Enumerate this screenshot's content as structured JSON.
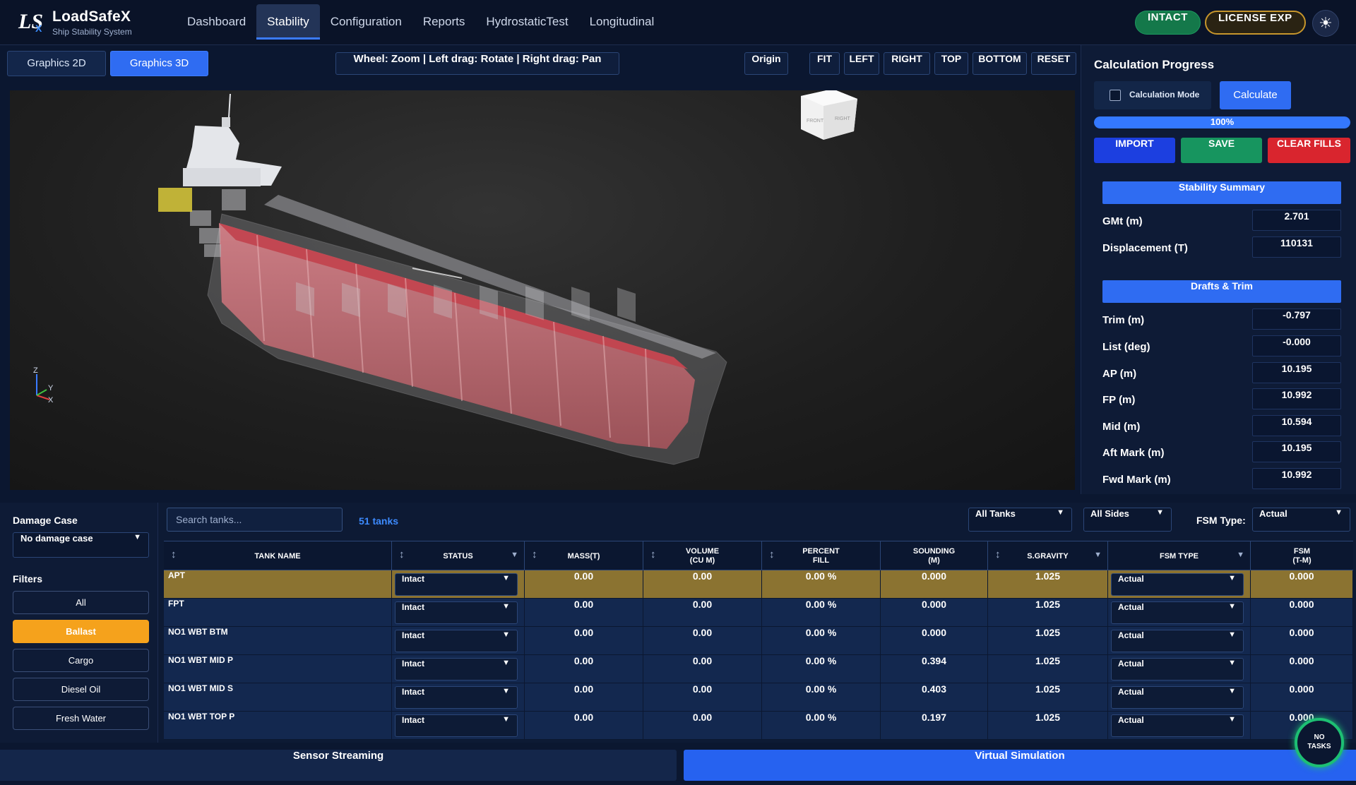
{
  "app": {
    "logo_mark": "LS",
    "logo_sub": "X",
    "name": "LoadSafeX",
    "subtitle": "Ship Stability System"
  },
  "nav": {
    "items": [
      {
        "label": "Dashboard"
      },
      {
        "label": "Stability",
        "active": true
      },
      {
        "label": "Configuration"
      },
      {
        "label": "Reports"
      },
      {
        "label": "HydrostaticTest"
      },
      {
        "label": "Longitudinal"
      }
    ]
  },
  "header": {
    "status_badge": "INTACT",
    "license_badge": "LICENSE EXP",
    "theme_icon": "sun-icon",
    "theme_glyph": "☀"
  },
  "graphics": {
    "tab_2d": "Graphics 2D",
    "tab_3d": "Graphics 3D",
    "hint": "Wheel: Zoom  |  Left drag: Rotate  |  Right drag: Pan",
    "origin": "Origin",
    "views": [
      "FIT",
      "LEFT",
      "RIGHT",
      "TOP",
      "BOTTOM",
      "RESET"
    ],
    "viewcube": {
      "front": "FRONT",
      "right": "RIGHT"
    },
    "axes": {
      "z": "Z",
      "y": "Y",
      "x": "X"
    }
  },
  "calc": {
    "title": "Calculation Progress",
    "mode_label": "Calculation Mode",
    "mode_checked": false,
    "calculate": "Calculate",
    "progress": 100,
    "progress_text": "100%",
    "import": "IMPORT",
    "save": "SAVE",
    "clear": "CLEAR FILLS"
  },
  "stability": {
    "title": "Stability Summary",
    "gmt_label": "GMt (m)",
    "gmt": "2.701",
    "disp_label": "Displacement (T)",
    "disp": "110131"
  },
  "drafts": {
    "title": "Drafts & Trim",
    "rows": [
      {
        "label": "Trim (m)",
        "value": "-0.797"
      },
      {
        "label": "List (deg)",
        "value": "-0.000"
      },
      {
        "label": "AP (m)",
        "value": "10.195"
      },
      {
        "label": "FP (m)",
        "value": "10.992"
      },
      {
        "label": "Mid (m)",
        "value": "10.594"
      },
      {
        "label": "Aft Mark (m)",
        "value": "10.195"
      },
      {
        "label": "Fwd Mark (m)",
        "value": "10.992"
      }
    ]
  },
  "damage": {
    "label": "Damage Case",
    "value": "No damage case"
  },
  "filters": {
    "label": "Filters",
    "items": [
      {
        "label": "All"
      },
      {
        "label": "Ballast",
        "active": true
      },
      {
        "label": "Cargo"
      },
      {
        "label": "Diesel Oil"
      },
      {
        "label": "Fresh Water"
      }
    ]
  },
  "table_tools": {
    "search_placeholder": "Search tanks...",
    "count": "51 tanks",
    "tank_filter": "All Tanks",
    "side_filter": "All Sides",
    "fsm_label": "FSM Type:",
    "fsm_value": "Actual"
  },
  "table": {
    "columns": [
      "TANK NAME",
      "STATUS",
      "MASS(T)",
      "VOLUME\n(CU M)",
      "PERCENT\nFILL",
      "SOUNDING\n(M)",
      "S.GRAVITY",
      "FSM TYPE",
      "FSM\n(T-M)"
    ],
    "rows": [
      {
        "name": "APT",
        "status": "Intact",
        "mass": "0.00",
        "volume": "0.00",
        "fill": "0.00 %",
        "sounding": "0.000",
        "sg": "1.025",
        "fsm_type": "Actual",
        "fsm": "0.000",
        "highlight": true
      },
      {
        "name": "FPT",
        "status": "Intact",
        "mass": "0.00",
        "volume": "0.00",
        "fill": "0.00 %",
        "sounding": "0.000",
        "sg": "1.025",
        "fsm_type": "Actual",
        "fsm": "0.000"
      },
      {
        "name": "NO1 WBT BTM",
        "status": "Intact",
        "mass": "0.00",
        "volume": "0.00",
        "fill": "0.00 %",
        "sounding": "0.000",
        "sg": "1.025",
        "fsm_type": "Actual",
        "fsm": "0.000"
      },
      {
        "name": "NO1 WBT MID P",
        "status": "Intact",
        "mass": "0.00",
        "volume": "0.00",
        "fill": "0.00 %",
        "sounding": "0.394",
        "sg": "1.025",
        "fsm_type": "Actual",
        "fsm": "0.000"
      },
      {
        "name": "NO1 WBT MID S",
        "status": "Intact",
        "mass": "0.00",
        "volume": "0.00",
        "fill": "0.00 %",
        "sounding": "0.403",
        "sg": "1.025",
        "fsm_type": "Actual",
        "fsm": "0.000"
      },
      {
        "name": "NO1 WBT TOP P",
        "status": "Intact",
        "mass": "0.00",
        "volume": "0.00",
        "fill": "0.00 %",
        "sounding": "0.197",
        "sg": "1.025",
        "fsm_type": "Actual",
        "fsm": "0.000"
      }
    ]
  },
  "bottom": {
    "sensor": "Sensor Streaming",
    "virtual": "Virtual Simulation",
    "tasks": "NO\nTASKS"
  },
  "colors": {
    "accent": "#2f6cf2",
    "success": "#17955f",
    "danger": "#d9252e",
    "warning": "#f5a21c",
    "highlight_row": "#8b7331"
  }
}
